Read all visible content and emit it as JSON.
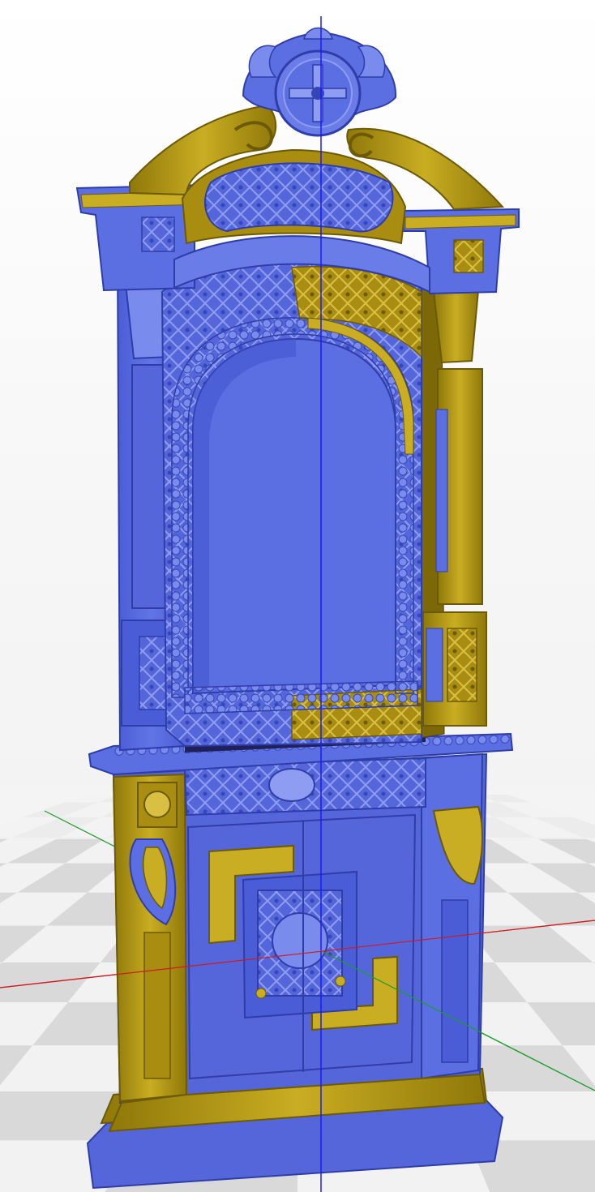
{
  "viewport": {
    "background_top": "#ffffff",
    "background_bottom": "#eeeeee",
    "floor_tile_light": "#f2f2f2",
    "floor_tile_dark": "#d9d9d9"
  },
  "axes": {
    "x_color": "#d11a1a",
    "y_color": "#1b9e2a",
    "z_color": "#1a1aff"
  },
  "model": {
    "name_icon": "iconostasis-kiot-3d-model",
    "colors": {
      "primary_surface": "#5b6fe3",
      "primary_shadow": "#3546b8",
      "primary_highlight": "#8e9cf2",
      "secondary_surface": "#b59a12",
      "secondary_shadow": "#7d6808",
      "secondary_highlight": "#d9c043"
    }
  }
}
